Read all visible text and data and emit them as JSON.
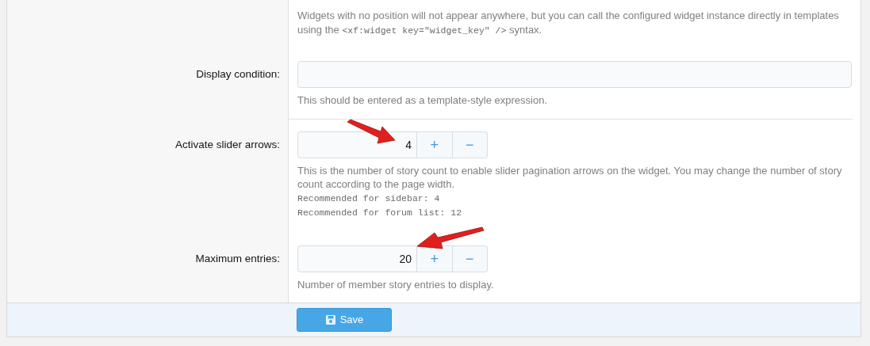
{
  "groups": [
    [
      {
        "hint": [
          {
            "kind": "text",
            "parts": [
              {
                "kind": "text",
                "text": "Widgets with no position will not appear anywhere, but you can call the configured widget instance directly in templates using the "
              },
              {
                "kind": "code",
                "text": "<xf:widget key=\"widget_key\" />"
              },
              {
                "kind": "text",
                "text": " syntax."
              }
            ]
          }
        ]
      },
      {
        "label": "Display condition:",
        "field": {
          "kind": "text"
        },
        "hint": [
          {
            "kind": "text",
            "parts": [
              {
                "kind": "text",
                "text": "This should be entered as a template-style expression."
              }
            ]
          }
        ]
      }
    ],
    [
      {
        "label": "Activate slider arrows:",
        "field": {
          "kind": "number",
          "value": "4",
          "plus": "+",
          "minus": "−"
        },
        "hint": [
          {
            "kind": "text",
            "parts": [
              {
                "kind": "text",
                "text": "This is the number of story count to enable slider pagination arrows on the widget. You may change the number of story count according to the page width."
              }
            ]
          },
          {
            "kind": "code",
            "parts": [
              {
                "kind": "code",
                "text": "Recommended for sidebar: 4"
              }
            ]
          },
          {
            "kind": "code",
            "parts": [
              {
                "kind": "code",
                "text": "Recommended for forum list: 12"
              }
            ]
          }
        ]
      },
      {
        "label": "Maximum entries:",
        "field": {
          "kind": "number",
          "value": "20",
          "plus": "+",
          "minus": "−"
        },
        "hint": [
          {
            "kind": "text",
            "parts": [
              {
                "kind": "text",
                "text": "Number of member story entries to display."
              }
            ]
          }
        ]
      }
    ]
  ],
  "save_button": "Save"
}
